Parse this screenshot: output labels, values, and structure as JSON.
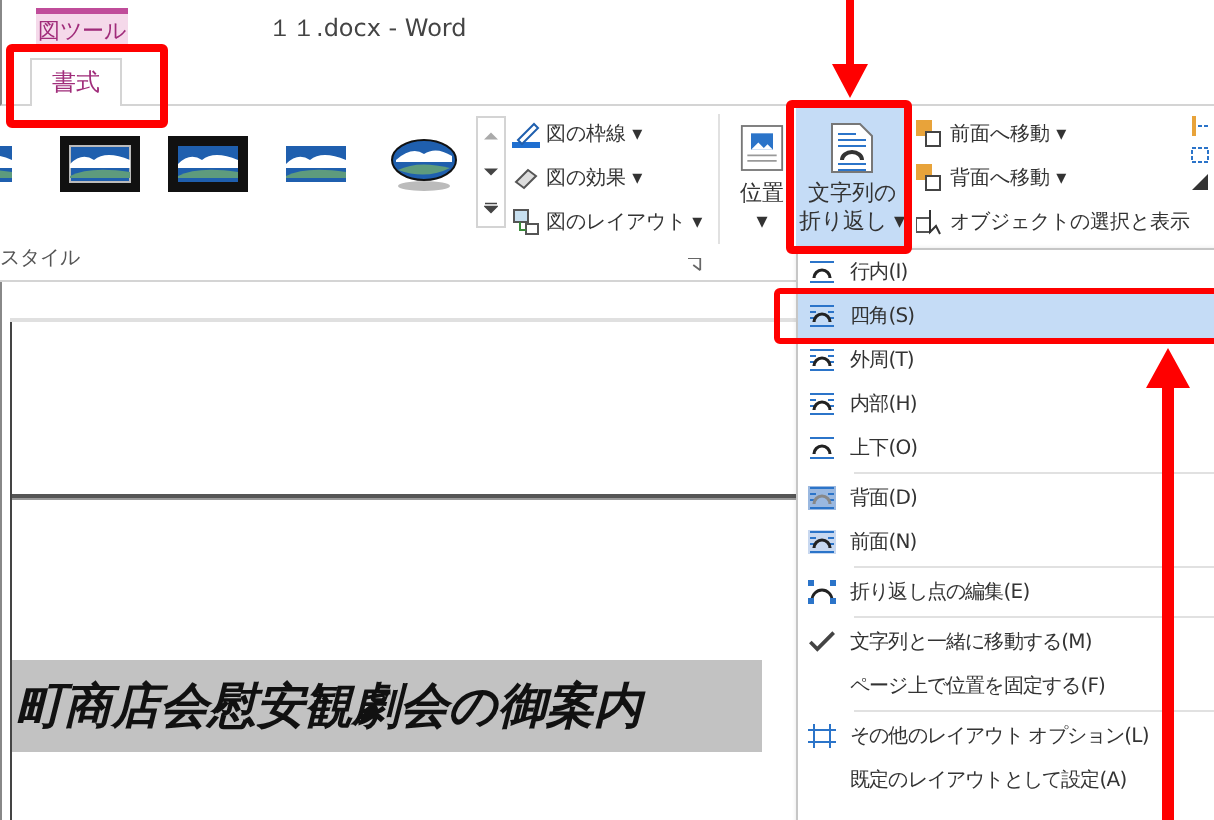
{
  "window": {
    "context_tab": "図ツール",
    "title": "１１.docx - Word"
  },
  "tabs": [
    {
      "label": "書式",
      "selected": true
    }
  ],
  "ribbon": {
    "style_commands": [
      {
        "label": "図の枠線",
        "dropdown": "▾"
      },
      {
        "label": "図の効果",
        "dropdown": "▾"
      },
      {
        "label": "図のレイアウト",
        "dropdown": "▾"
      }
    ],
    "group_label": "スタイル",
    "position_button": {
      "label": "位置",
      "dropdown": "▾"
    },
    "wrap_button": {
      "label": "文字列の",
      "label2": "折り返し",
      "dropdown": "▾",
      "pressed": true
    },
    "arrange_commands": [
      {
        "label": "前面へ移動",
        "dropdown": "▾"
      },
      {
        "label": "背面へ移動",
        "dropdown": "▾"
      },
      {
        "label": "オブジェクトの選択と表示"
      }
    ]
  },
  "document": {
    "heading": "町商店会慰安観劇会の御案内"
  },
  "menu": {
    "sections": [
      [
        {
          "label": "行内(I)",
          "highlighted": false
        },
        {
          "label": "四角(S)",
          "highlighted": true
        },
        {
          "label": "外周(T)",
          "highlighted": false
        },
        {
          "label": "内部(H)",
          "highlighted": false
        },
        {
          "label": "上下(O)",
          "highlighted": false
        }
      ],
      [
        {
          "label": "背面(D)",
          "highlighted": false
        },
        {
          "label": "前面(N)",
          "highlighted": false
        }
      ],
      [
        {
          "label": "折り返し点の編集(E)",
          "highlighted": false
        }
      ],
      [
        {
          "label": "文字列と一緒に移動する(M)",
          "highlighted": false,
          "checked": true
        },
        {
          "label": "ページ上で位置を固定する(F)",
          "highlighted": false,
          "checked": false
        }
      ],
      [
        {
          "label": "その他のレイアウト オプション(L)",
          "highlighted": false
        },
        {
          "label": "既定のレイアウトとして設定(A)",
          "highlighted": false
        }
      ]
    ]
  }
}
